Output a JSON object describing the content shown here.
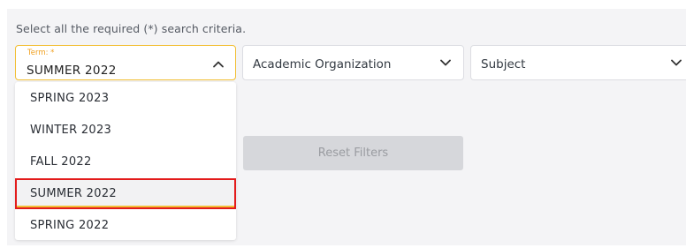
{
  "instructions": "Select all the required (*) search criteria.",
  "term": {
    "label": "Term: *",
    "value": "SUMMER 2022",
    "expanded": true,
    "options": [
      "SPRING 2023",
      "WINTER 2023",
      "FALL 2022",
      "SUMMER 2022",
      "SPRING 2022"
    ],
    "selected_index": 3
  },
  "academic_organization": {
    "placeholder": "Academic Organization"
  },
  "subject": {
    "placeholder": "Subject"
  },
  "reset_button": {
    "label": "Reset Filters",
    "enabled": false
  },
  "colors": {
    "accent": "#f2bf34",
    "label": "#f0a020",
    "highlight_border": "#e31b1b",
    "disabled_button_bg": "#d6d7db",
    "panel_bg": "#f4f4f6"
  },
  "icons": {
    "term_toggle": "chevron-up-icon",
    "org_toggle": "chevron-down-icon",
    "subject_toggle": "chevron-down-icon"
  }
}
